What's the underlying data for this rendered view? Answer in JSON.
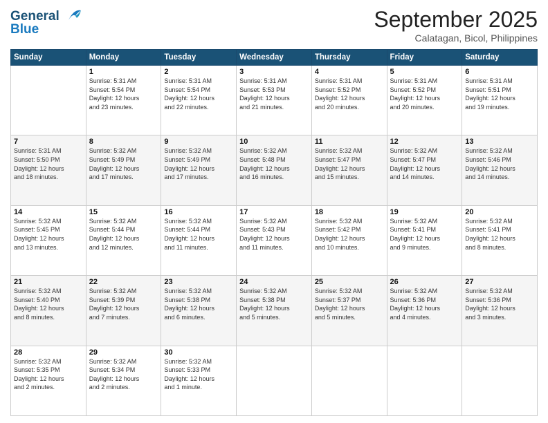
{
  "header": {
    "logo_line1": "General",
    "logo_line2": "Blue",
    "month_title": "September 2025",
    "location": "Calatagan, Bicol, Philippines"
  },
  "weekdays": [
    "Sunday",
    "Monday",
    "Tuesday",
    "Wednesday",
    "Thursday",
    "Friday",
    "Saturday"
  ],
  "weeks": [
    [
      {
        "day": "",
        "info": ""
      },
      {
        "day": "1",
        "info": "Sunrise: 5:31 AM\nSunset: 5:54 PM\nDaylight: 12 hours\nand 23 minutes."
      },
      {
        "day": "2",
        "info": "Sunrise: 5:31 AM\nSunset: 5:54 PM\nDaylight: 12 hours\nand 22 minutes."
      },
      {
        "day": "3",
        "info": "Sunrise: 5:31 AM\nSunset: 5:53 PM\nDaylight: 12 hours\nand 21 minutes."
      },
      {
        "day": "4",
        "info": "Sunrise: 5:31 AM\nSunset: 5:52 PM\nDaylight: 12 hours\nand 20 minutes."
      },
      {
        "day": "5",
        "info": "Sunrise: 5:31 AM\nSunset: 5:52 PM\nDaylight: 12 hours\nand 20 minutes."
      },
      {
        "day": "6",
        "info": "Sunrise: 5:31 AM\nSunset: 5:51 PM\nDaylight: 12 hours\nand 19 minutes."
      }
    ],
    [
      {
        "day": "7",
        "info": "Sunrise: 5:31 AM\nSunset: 5:50 PM\nDaylight: 12 hours\nand 18 minutes."
      },
      {
        "day": "8",
        "info": "Sunrise: 5:32 AM\nSunset: 5:49 PM\nDaylight: 12 hours\nand 17 minutes."
      },
      {
        "day": "9",
        "info": "Sunrise: 5:32 AM\nSunset: 5:49 PM\nDaylight: 12 hours\nand 17 minutes."
      },
      {
        "day": "10",
        "info": "Sunrise: 5:32 AM\nSunset: 5:48 PM\nDaylight: 12 hours\nand 16 minutes."
      },
      {
        "day": "11",
        "info": "Sunrise: 5:32 AM\nSunset: 5:47 PM\nDaylight: 12 hours\nand 15 minutes."
      },
      {
        "day": "12",
        "info": "Sunrise: 5:32 AM\nSunset: 5:47 PM\nDaylight: 12 hours\nand 14 minutes."
      },
      {
        "day": "13",
        "info": "Sunrise: 5:32 AM\nSunset: 5:46 PM\nDaylight: 12 hours\nand 14 minutes."
      }
    ],
    [
      {
        "day": "14",
        "info": "Sunrise: 5:32 AM\nSunset: 5:45 PM\nDaylight: 12 hours\nand 13 minutes."
      },
      {
        "day": "15",
        "info": "Sunrise: 5:32 AM\nSunset: 5:44 PM\nDaylight: 12 hours\nand 12 minutes."
      },
      {
        "day": "16",
        "info": "Sunrise: 5:32 AM\nSunset: 5:44 PM\nDaylight: 12 hours\nand 11 minutes."
      },
      {
        "day": "17",
        "info": "Sunrise: 5:32 AM\nSunset: 5:43 PM\nDaylight: 12 hours\nand 11 minutes."
      },
      {
        "day": "18",
        "info": "Sunrise: 5:32 AM\nSunset: 5:42 PM\nDaylight: 12 hours\nand 10 minutes."
      },
      {
        "day": "19",
        "info": "Sunrise: 5:32 AM\nSunset: 5:41 PM\nDaylight: 12 hours\nand 9 minutes."
      },
      {
        "day": "20",
        "info": "Sunrise: 5:32 AM\nSunset: 5:41 PM\nDaylight: 12 hours\nand 8 minutes."
      }
    ],
    [
      {
        "day": "21",
        "info": "Sunrise: 5:32 AM\nSunset: 5:40 PM\nDaylight: 12 hours\nand 8 minutes."
      },
      {
        "day": "22",
        "info": "Sunrise: 5:32 AM\nSunset: 5:39 PM\nDaylight: 12 hours\nand 7 minutes."
      },
      {
        "day": "23",
        "info": "Sunrise: 5:32 AM\nSunset: 5:38 PM\nDaylight: 12 hours\nand 6 minutes."
      },
      {
        "day": "24",
        "info": "Sunrise: 5:32 AM\nSunset: 5:38 PM\nDaylight: 12 hours\nand 5 minutes."
      },
      {
        "day": "25",
        "info": "Sunrise: 5:32 AM\nSunset: 5:37 PM\nDaylight: 12 hours\nand 5 minutes."
      },
      {
        "day": "26",
        "info": "Sunrise: 5:32 AM\nSunset: 5:36 PM\nDaylight: 12 hours\nand 4 minutes."
      },
      {
        "day": "27",
        "info": "Sunrise: 5:32 AM\nSunset: 5:36 PM\nDaylight: 12 hours\nand 3 minutes."
      }
    ],
    [
      {
        "day": "28",
        "info": "Sunrise: 5:32 AM\nSunset: 5:35 PM\nDaylight: 12 hours\nand 2 minutes."
      },
      {
        "day": "29",
        "info": "Sunrise: 5:32 AM\nSunset: 5:34 PM\nDaylight: 12 hours\nand 2 minutes."
      },
      {
        "day": "30",
        "info": "Sunrise: 5:32 AM\nSunset: 5:33 PM\nDaylight: 12 hours\nand 1 minute."
      },
      {
        "day": "",
        "info": ""
      },
      {
        "day": "",
        "info": ""
      },
      {
        "day": "",
        "info": ""
      },
      {
        "day": "",
        "info": ""
      }
    ]
  ]
}
